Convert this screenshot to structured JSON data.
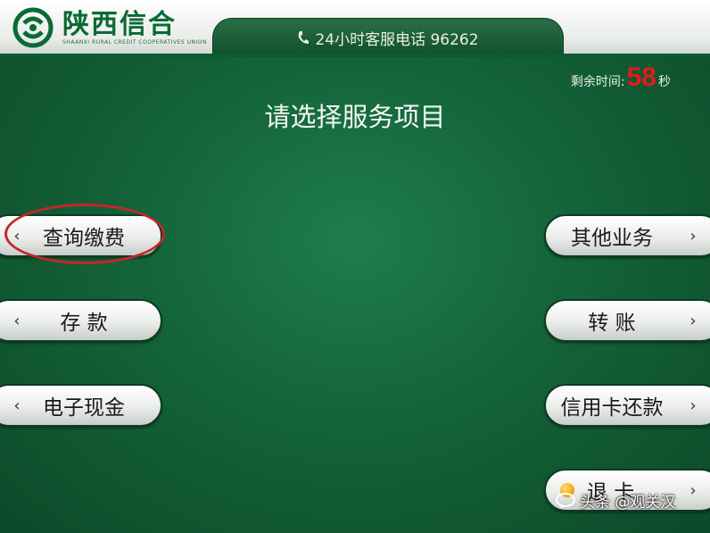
{
  "header": {
    "logo_cn": "陕西信合",
    "logo_en": "SHAANXI RURAL CREDIT COOPERATIVES UNION",
    "hotline": "24小时客服电话 96262"
  },
  "timer": {
    "label": "剩余时间:",
    "value": "58",
    "unit": "秒"
  },
  "title": "请选择服务项目",
  "left_buttons": [
    {
      "label": "查询缴费"
    },
    {
      "label": "存  款"
    },
    {
      "label": "电子现金"
    }
  ],
  "right_buttons": [
    {
      "label": "其他业务"
    },
    {
      "label": "转  账"
    },
    {
      "label": "信用卡还款"
    },
    {
      "label": "退  卡"
    }
  ],
  "chevrons": {
    "left": "‹",
    "right": "›"
  },
  "watermark": "头条 @观关汉",
  "colors": {
    "brand_green": "#0b6a34",
    "highlight_red": "#c1272d",
    "timer_red": "#e21b1b"
  }
}
